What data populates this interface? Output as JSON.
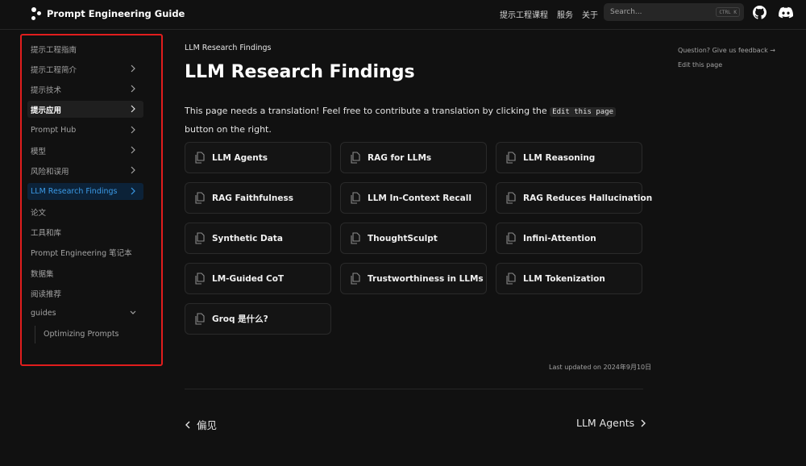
{
  "header": {
    "logo_text": "Prompt Engineering Guide",
    "nav": [
      "提示工程课程",
      "服务",
      "关于"
    ],
    "search_placeholder": "Search...",
    "search_shortcut": "CTRL K"
  },
  "sidebar": {
    "items": [
      {
        "label": "提示工程指南",
        "chevron": false
      },
      {
        "label": "提示工程简介",
        "chevron": true
      },
      {
        "label": "提示技术",
        "chevron": true
      },
      {
        "label": "提示应用",
        "chevron": true
      },
      {
        "label": "Prompt Hub",
        "chevron": true
      },
      {
        "label": "模型",
        "chevron": true
      },
      {
        "label": "风险和误用",
        "chevron": true
      },
      {
        "label": "LLM Research Findings",
        "chevron": true
      },
      {
        "label": "论文",
        "chevron": false
      },
      {
        "label": "工具和库",
        "chevron": false
      },
      {
        "label": "Prompt Engineering 笔记本",
        "chevron": false
      },
      {
        "label": "数据集",
        "chevron": false
      },
      {
        "label": "阅读推荐",
        "chevron": false
      },
      {
        "label": "guides",
        "chevron": true
      }
    ],
    "sub_items": [
      "Optimizing Prompts"
    ]
  },
  "main": {
    "breadcrumb": "LLM Research Findings",
    "title": "LLM Research Findings",
    "notice_before": "This page needs a translation! Feel free to contribute a translation by clicking the ",
    "notice_code": "Edit this page",
    "notice_after": " button on the right.",
    "cards": [
      "LLM Agents",
      "RAG for LLMs",
      "LLM Reasoning",
      "RAG Faithfulness",
      "LLM In-Context Recall",
      "RAG Reduces Hallucination",
      "Synthetic Data",
      "ThoughtSculpt",
      "Infini-Attention",
      "LM-Guided CoT",
      "Trustworthiness in LLMs",
      "LLM Tokenization",
      "Groq 是什么?"
    ],
    "last_updated": "Last updated on 2024年9月10日",
    "prev_label": "偏见",
    "next_label": "LLM Agents"
  },
  "toc": {
    "feedback": "Question? Give us feedback →",
    "edit": "Edit this page"
  }
}
